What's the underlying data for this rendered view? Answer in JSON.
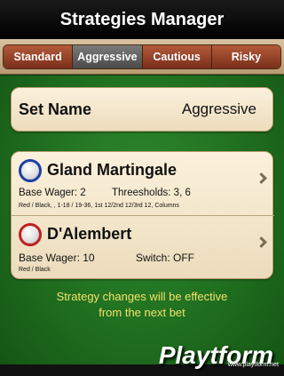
{
  "header": {
    "title": "Strategies Manager"
  },
  "tabs": [
    {
      "label": "Standard",
      "active": false
    },
    {
      "label": "Aggressive",
      "active": true
    },
    {
      "label": "Cautious",
      "active": false
    },
    {
      "label": "Risky",
      "active": false
    }
  ],
  "set": {
    "label": "Set Name",
    "value": "Aggressive"
  },
  "strategies": [
    {
      "name": "Gland Martingale",
      "base_wager": "Base Wager: 2",
      "extra": "Threesholds: 3, 6",
      "bets": "Red / Black, , 1-18 / 19-36, 1st 12/2nd 12/3rd 12, Columns",
      "color": "#1d3fa3"
    },
    {
      "name": "D'Alembert",
      "base_wager": "Base Wager: 10",
      "extra": "Switch: OFF",
      "bets": "Red / Black",
      "color": "#c21f1f"
    }
  ],
  "notice": {
    "line1": "Strategy changes will be effective",
    "line2": "from the next bet"
  },
  "watermark": {
    "brand": "Playtform",
    "url": "www.playtform.net"
  }
}
